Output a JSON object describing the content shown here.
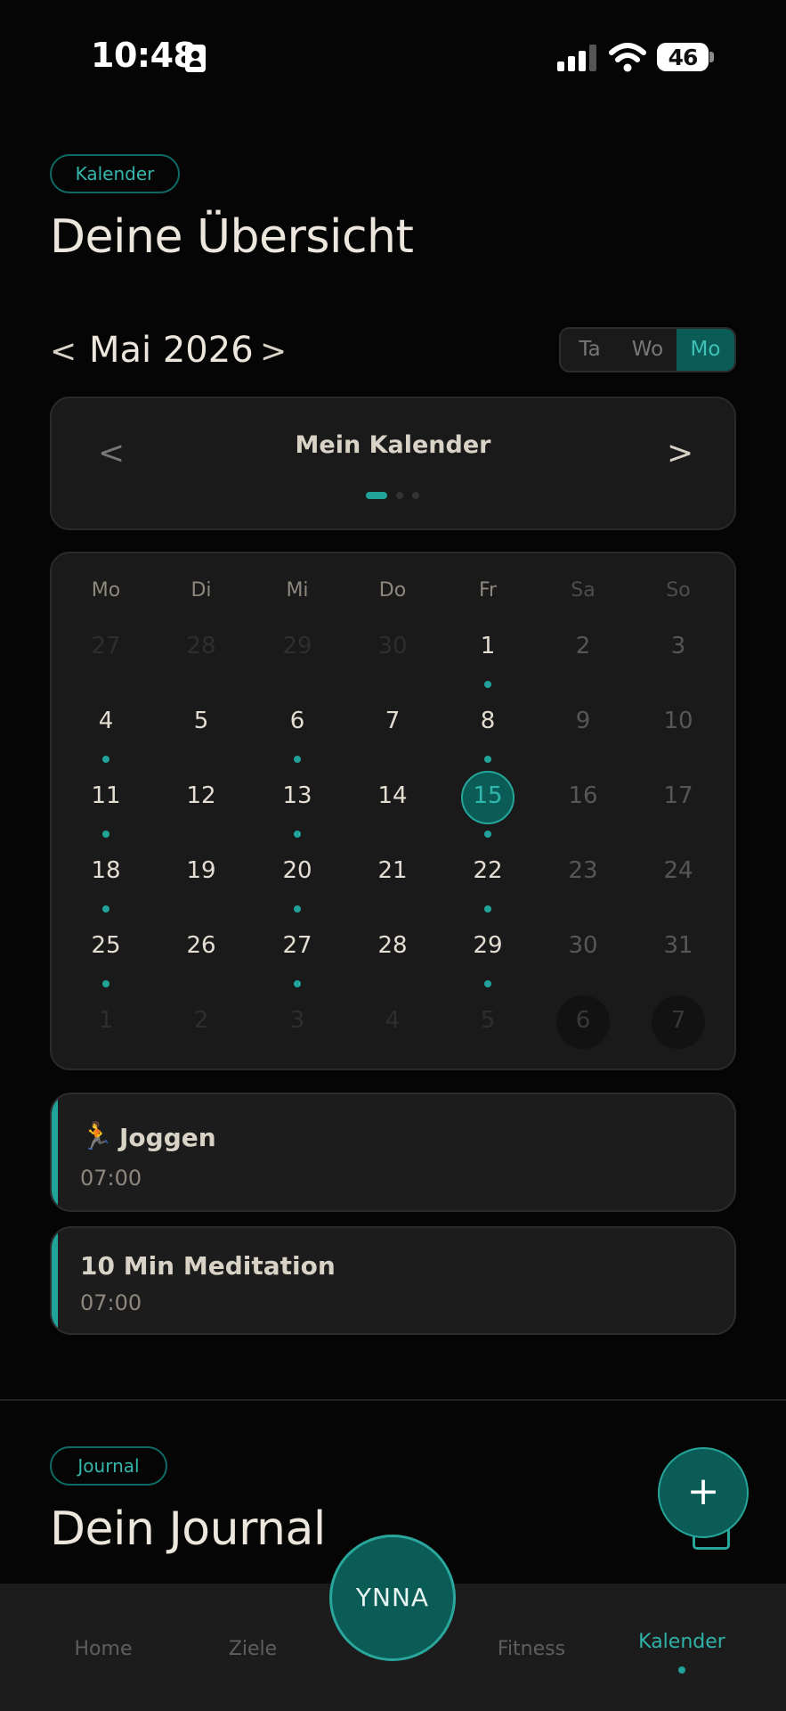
{
  "status_bar": {
    "time": "10:48",
    "battery": "46"
  },
  "calendar_section": {
    "tag": "Kalender",
    "title": "Deine Übersicht",
    "month": "Mai 2026",
    "prev_arrow": "<",
    "next_arrow": ">",
    "view_modes": [
      {
        "label": "Ta",
        "active": false
      },
      {
        "label": "Wo",
        "active": false
      },
      {
        "label": "Mo",
        "active": true
      }
    ],
    "calendar_selector": {
      "title": "Mein Kalender",
      "prev": "<",
      "next": ">",
      "page_count": 3,
      "active_page": 0
    },
    "weekdays": [
      "Mo",
      "Di",
      "Mi",
      "Do",
      "Fr",
      "Sa",
      "So"
    ],
    "weeks": [
      [
        {
          "d": "27",
          "t": "out"
        },
        {
          "d": "28",
          "t": "out"
        },
        {
          "d": "29",
          "t": "out"
        },
        {
          "d": "30",
          "t": "out"
        },
        {
          "d": "1",
          "t": "in",
          "e": true
        },
        {
          "d": "2",
          "t": "we"
        },
        {
          "d": "3",
          "t": "we"
        }
      ],
      [
        {
          "d": "4",
          "t": "in",
          "e": true
        },
        {
          "d": "5",
          "t": "in"
        },
        {
          "d": "6",
          "t": "in",
          "e": true
        },
        {
          "d": "7",
          "t": "in"
        },
        {
          "d": "8",
          "t": "in",
          "e": true
        },
        {
          "d": "9",
          "t": "we"
        },
        {
          "d": "10",
          "t": "we"
        }
      ],
      [
        {
          "d": "11",
          "t": "in",
          "e": true
        },
        {
          "d": "12",
          "t": "in"
        },
        {
          "d": "13",
          "t": "in",
          "e": true
        },
        {
          "d": "14",
          "t": "in"
        },
        {
          "d": "15",
          "t": "today",
          "e": true
        },
        {
          "d": "16",
          "t": "we"
        },
        {
          "d": "17",
          "t": "we"
        }
      ],
      [
        {
          "d": "18",
          "t": "in",
          "e": true
        },
        {
          "d": "19",
          "t": "in"
        },
        {
          "d": "20",
          "t": "in",
          "e": true
        },
        {
          "d": "21",
          "t": "in"
        },
        {
          "d": "22",
          "t": "in",
          "e": true
        },
        {
          "d": "23",
          "t": "we"
        },
        {
          "d": "24",
          "t": "we"
        }
      ],
      [
        {
          "d": "25",
          "t": "in",
          "e": true
        },
        {
          "d": "26",
          "t": "in"
        },
        {
          "d": "27",
          "t": "in",
          "e": true
        },
        {
          "d": "28",
          "t": "in"
        },
        {
          "d": "29",
          "t": "in",
          "e": true
        },
        {
          "d": "30",
          "t": "we"
        },
        {
          "d": "31",
          "t": "we"
        }
      ],
      [
        {
          "d": "1",
          "t": "out"
        },
        {
          "d": "2",
          "t": "out"
        },
        {
          "d": "3",
          "t": "out"
        },
        {
          "d": "4",
          "t": "out"
        },
        {
          "d": "5",
          "t": "out"
        },
        {
          "d": "6",
          "t": "outwe"
        },
        {
          "d": "7",
          "t": "outwe"
        }
      ]
    ],
    "events": [
      {
        "emoji": "🏃",
        "title": "Joggen",
        "time": "07:00"
      },
      {
        "emoji": "",
        "title": "10 Min Meditation",
        "time": "07:00"
      }
    ]
  },
  "journal_section": {
    "tag": "Journal",
    "title": "Dein Journal"
  },
  "fab": {
    "label": "+"
  },
  "bottom_nav": {
    "logo": "YNNA",
    "tabs": [
      {
        "label": "Home",
        "active": false
      },
      {
        "label": "Ziele",
        "active": false
      },
      {
        "label": "Fitness",
        "active": false
      },
      {
        "label": "Kalender",
        "active": true
      }
    ]
  },
  "colors": {
    "accent": "#21a39a",
    "accent_dark": "#0b5b57",
    "background": "#050505",
    "panel": "#1a1a1a"
  }
}
